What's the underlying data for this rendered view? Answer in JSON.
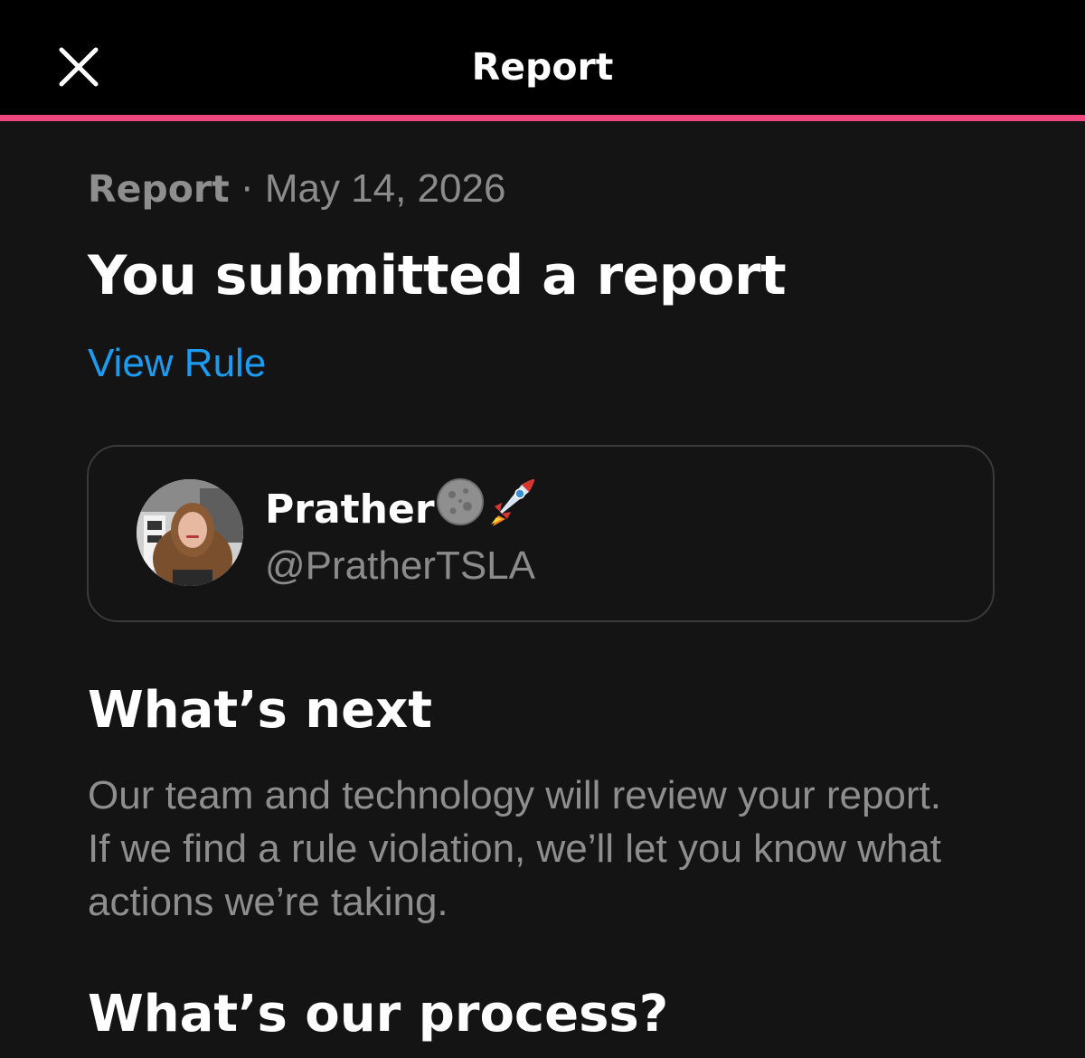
{
  "header": {
    "title": "Report",
    "close_icon": "close-icon"
  },
  "colors": {
    "accent_line": "#f0487e",
    "link": "#1d9bf0",
    "background": "#141414",
    "topbar": "#000000"
  },
  "report": {
    "meta_label": "Report",
    "meta_separator": " · ",
    "date": "May 14, 2026",
    "headline": "You submitted a report",
    "view_rule_label": "View Rule"
  },
  "reported_user": {
    "display_name": "Prather",
    "emojis": [
      "moon-icon",
      "rocket-icon"
    ],
    "handle": "@PratherTSLA",
    "avatar": "avatar"
  },
  "whats_next": {
    "heading": "What’s next",
    "body": "Our team and technology will review your report. If we find a rule violation, we’ll let you know what actions we’re taking."
  },
  "process": {
    "heading": "What’s our process?"
  }
}
